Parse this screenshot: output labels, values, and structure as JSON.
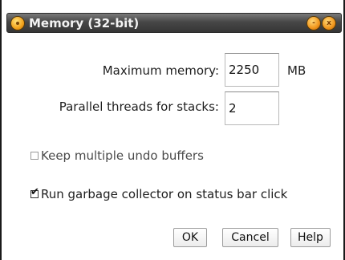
{
  "window": {
    "title": "Memory (32-bit)"
  },
  "titlebar": {
    "menu_icon": "orb-menu-icon",
    "minimize_glyph": "-",
    "close_glyph": "x"
  },
  "fields": {
    "max_memory": {
      "label": "Maximum memory:",
      "value": "2250",
      "unit": "MB"
    },
    "parallel_threads": {
      "label": "Parallel threads for stacks:",
      "value": "2"
    }
  },
  "options": {
    "keep_undo": {
      "label": "Keep multiple undo buffers",
      "checked": false,
      "enabled": false
    },
    "run_gc": {
      "label": "Run garbage collector on status bar click",
      "checked": true,
      "enabled": true
    }
  },
  "buttons": {
    "ok": "OK",
    "cancel": "Cancel",
    "help": "Help"
  },
  "colors": {
    "titlebar": "#474747",
    "title_text": "#f3f3f3",
    "orb": "#f0951b"
  }
}
